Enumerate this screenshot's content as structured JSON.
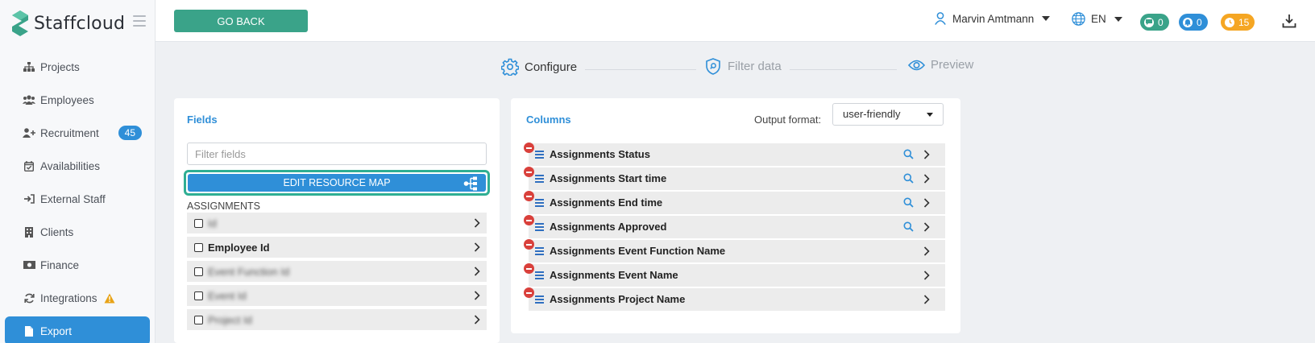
{
  "app": {
    "name": "Staffcloud",
    "brand_color": "#3aa389",
    "accent_color": "#2f8fd8"
  },
  "sidebar": {
    "items": [
      {
        "label": "Projects",
        "icon": "sitemap-icon"
      },
      {
        "label": "Employees",
        "icon": "users-icon"
      },
      {
        "label": "Recruitment",
        "icon": "user-plus-icon",
        "badge": "45"
      },
      {
        "label": "Availabilities",
        "icon": "calendar-check-icon"
      },
      {
        "label": "External Staff",
        "icon": "sign-in-icon"
      },
      {
        "label": "Clients",
        "icon": "building-icon"
      },
      {
        "label": "Finance",
        "icon": "money-bill-icon"
      },
      {
        "label": "Integrations",
        "icon": "sync-icon",
        "warning": true
      },
      {
        "label": "Export",
        "icon": "file-icon",
        "active": true
      }
    ]
  },
  "topbar": {
    "back_label": "GO BACK",
    "user_name": "Marvin Amtmann",
    "language": "EN",
    "counters": [
      {
        "icon": "chat-icon",
        "value": "0",
        "color": "#3aa389"
      },
      {
        "icon": "bell-icon",
        "value": "0",
        "color": "#2f8fd8"
      },
      {
        "icon": "clock-icon",
        "value": "15",
        "color": "#f5a623"
      }
    ]
  },
  "stepper": {
    "steps": [
      {
        "label": "Configure",
        "icon": "gear-icon",
        "active": true
      },
      {
        "label": "Filter data",
        "icon": "shield-search-icon",
        "active": false
      },
      {
        "label": "Preview",
        "icon": "eye-icon",
        "active": false
      }
    ]
  },
  "fields": {
    "title": "Fields",
    "filter_placeholder": "Filter fields",
    "edit_resource_map_label": "EDIT RESOURCE MAP",
    "group_label": "ASSIGNMENTS",
    "rows": [
      {
        "label": "Id",
        "blurred": true
      },
      {
        "label": "Employee Id",
        "blurred": false
      },
      {
        "label": "Event Function Id",
        "blurred": true
      },
      {
        "label": "Event Id",
        "blurred": true
      },
      {
        "label": "Project Id",
        "blurred": true
      }
    ]
  },
  "columns": {
    "title": "Columns",
    "output_format_label": "Output format:",
    "output_format_value": "user-friendly",
    "rows": [
      {
        "label": "Assignments Status",
        "searchable": true
      },
      {
        "label": "Assignments Start time",
        "searchable": true
      },
      {
        "label": "Assignments End time",
        "searchable": true
      },
      {
        "label": "Assignments Approved",
        "searchable": true
      },
      {
        "label": "Assignments Event Function Name",
        "searchable": false
      },
      {
        "label": "Assignments Event Name",
        "searchable": false
      },
      {
        "label": "Assignments Project Name",
        "searchable": false
      }
    ]
  }
}
